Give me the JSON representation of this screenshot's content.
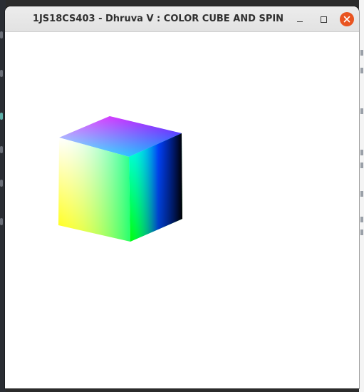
{
  "window": {
    "title": "1JS18CS403 - Dhruva V : COLOR CUBE AND SPIN",
    "controls": {
      "minimize_icon": "minimize-icon",
      "maximize_icon": "maximize-icon",
      "close_icon": "close-icon",
      "close_color": "#e95420"
    }
  },
  "canvas": {
    "background": "#ffffff",
    "object": "color-cube",
    "cube_colors": {
      "top_left": "#ffffff",
      "top_back": "#ff00ff",
      "top_right": "#0000ff",
      "top_front": "#00ffff",
      "bottom_left": "#ffff00",
      "bottom_front": "#00ff00",
      "bottom_right": "#000000"
    }
  }
}
